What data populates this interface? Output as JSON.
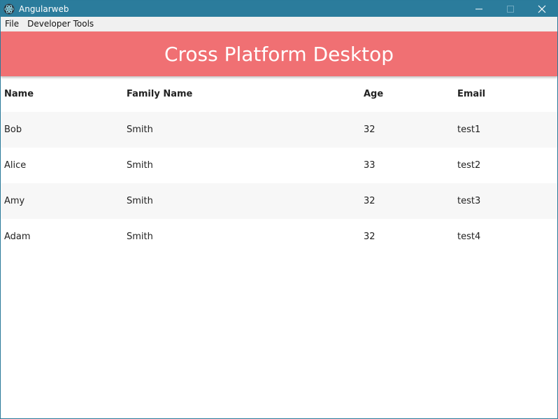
{
  "window": {
    "title": "Angularweb",
    "accent": "#2b7c9c",
    "controls": {
      "minimize": "minimize-icon",
      "maximize": "maximize-icon",
      "close": "close-icon"
    }
  },
  "menu": [
    "File",
    "Developer Tools"
  ],
  "header": {
    "title": "Cross Platform Desktop",
    "color": "#f07073"
  },
  "table": {
    "columns": [
      "Name",
      "Family Name",
      "Age",
      "Email"
    ],
    "rows": [
      [
        "Bob",
        "Smith",
        "32",
        "test1"
      ],
      [
        "Alice",
        "Smith",
        "33",
        "test2"
      ],
      [
        "Amy",
        "Smith",
        "32",
        "test3"
      ],
      [
        "Adam",
        "Smith",
        "32",
        "test4"
      ]
    ]
  }
}
